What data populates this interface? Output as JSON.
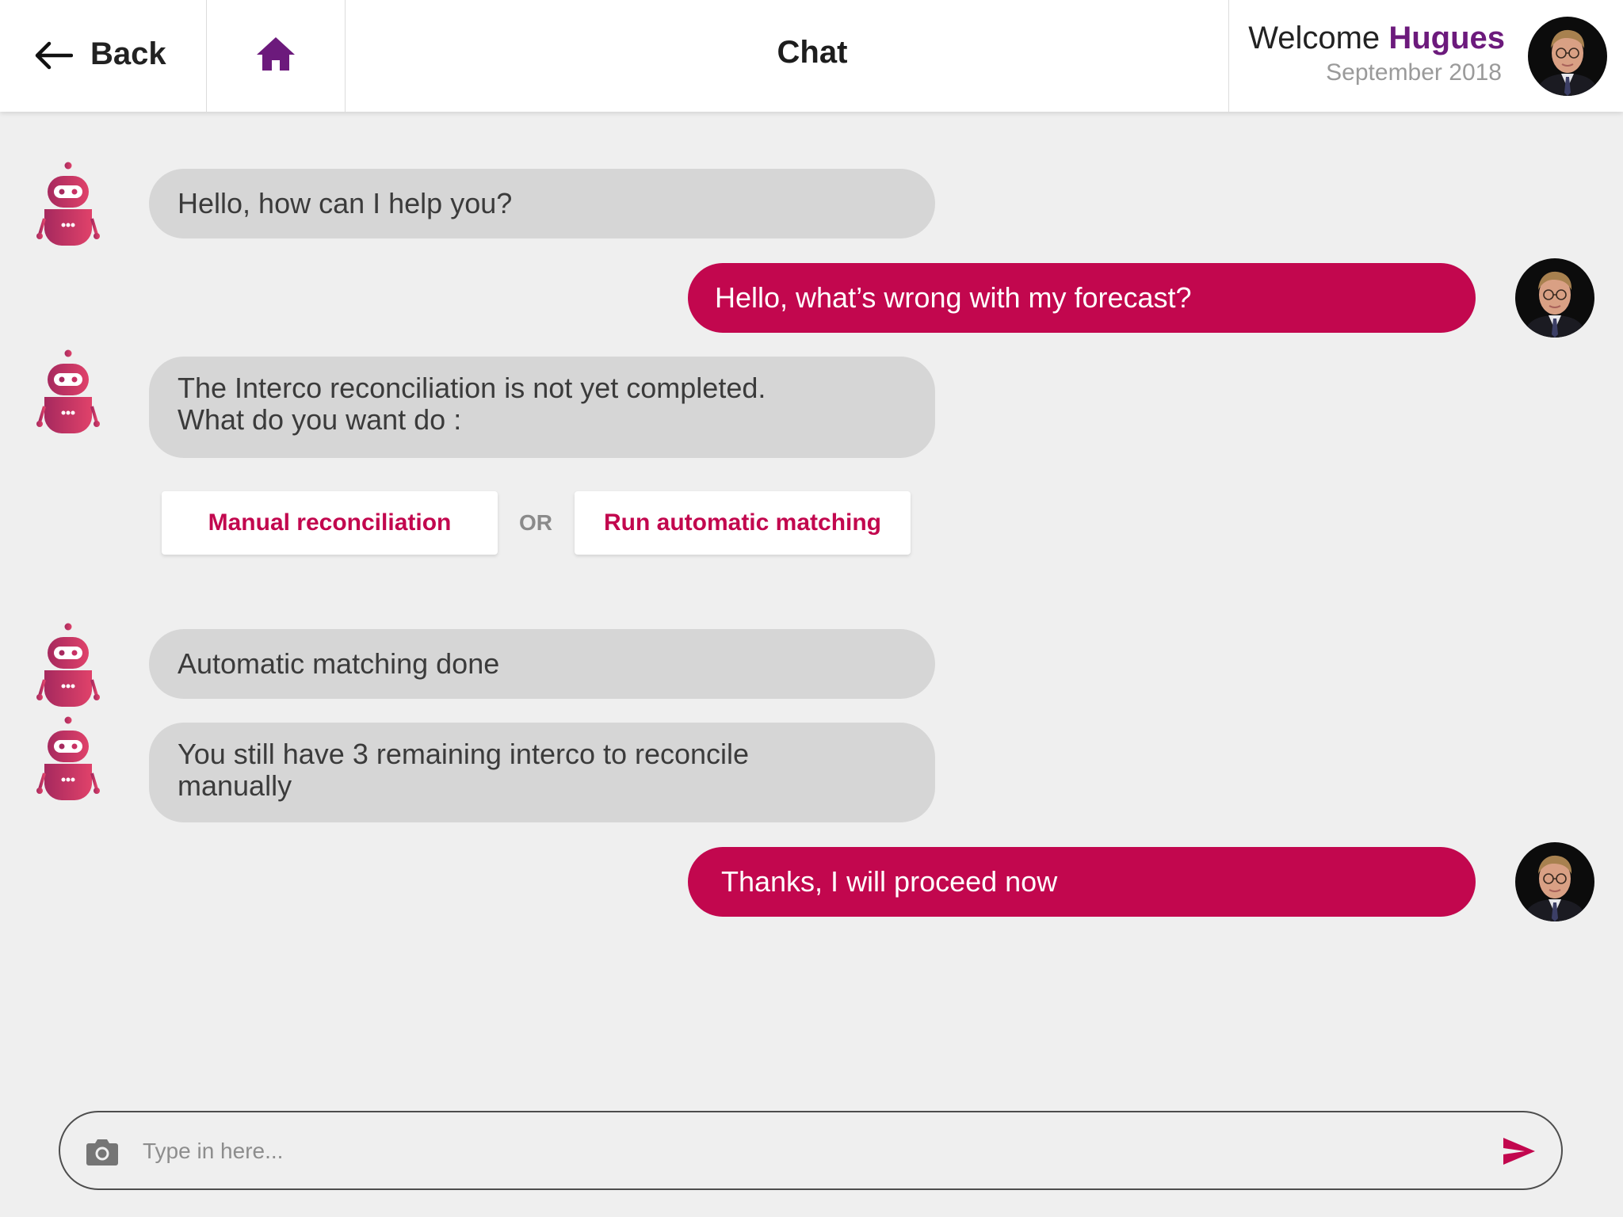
{
  "header": {
    "back_label": "Back",
    "title": "Chat",
    "welcome_prefix": "Welcome",
    "user_name": "Hugues",
    "period": "September 2018"
  },
  "messages": [
    {
      "from": "bot",
      "text": "Hello, how can I help you?"
    },
    {
      "from": "user",
      "text": "Hello, what’s wrong with my forecast?"
    },
    {
      "from": "bot",
      "lines": [
        "The Interco reconciliation is not yet completed.",
        "What do you want do :"
      ]
    },
    {
      "from": "bot",
      "text": "Automatic matching done"
    },
    {
      "from": "bot",
      "lines": [
        "You still have 3 remaining interco to reconcile",
        "manually"
      ]
    },
    {
      "from": "user",
      "text": "Thanks, I will proceed now"
    }
  ],
  "choices": {
    "manual_label": "Manual reconciliation",
    "or_label": "OR",
    "automatic_label": "Run automatic matching"
  },
  "composer": {
    "placeholder": "Type in here..."
  },
  "icons": {
    "back": "arrow-left-icon",
    "home": "home-icon",
    "bot": "robot-icon",
    "camera": "camera-icon",
    "send": "send-icon"
  },
  "colors": {
    "accent": "#c2074e",
    "brand_purple": "#6c1a7c",
    "bot_bubble": "#d6d6d6",
    "background": "#efefef"
  }
}
